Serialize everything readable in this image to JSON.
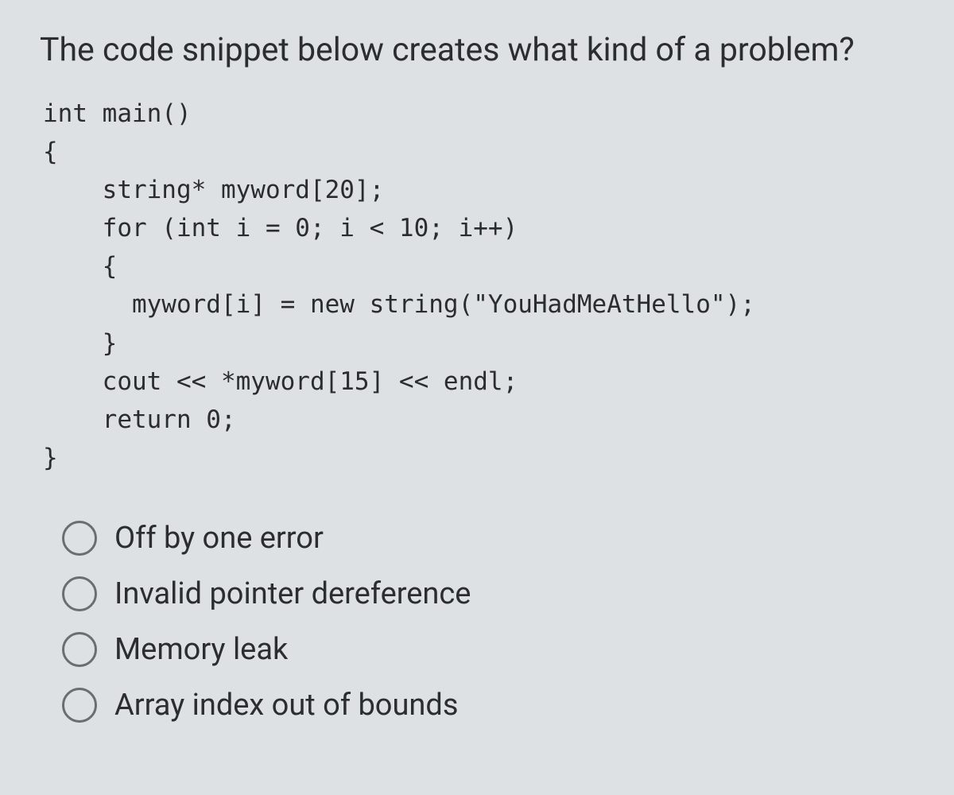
{
  "question": {
    "prompt": "The code snippet below creates what kind of a problem?",
    "code": "int main()\n{\n    string* myword[20];\n    for (int i = 0; i < 10; i++)\n    {\n      myword[i] = new string(\"YouHadMeAtHello\");\n    }\n    cout << *myword[15] << endl;\n    return 0;\n}"
  },
  "options": [
    {
      "label": "Off by one error"
    },
    {
      "label": "Invalid pointer dereference"
    },
    {
      "label": "Memory leak"
    },
    {
      "label": "Array index out of bounds"
    }
  ]
}
